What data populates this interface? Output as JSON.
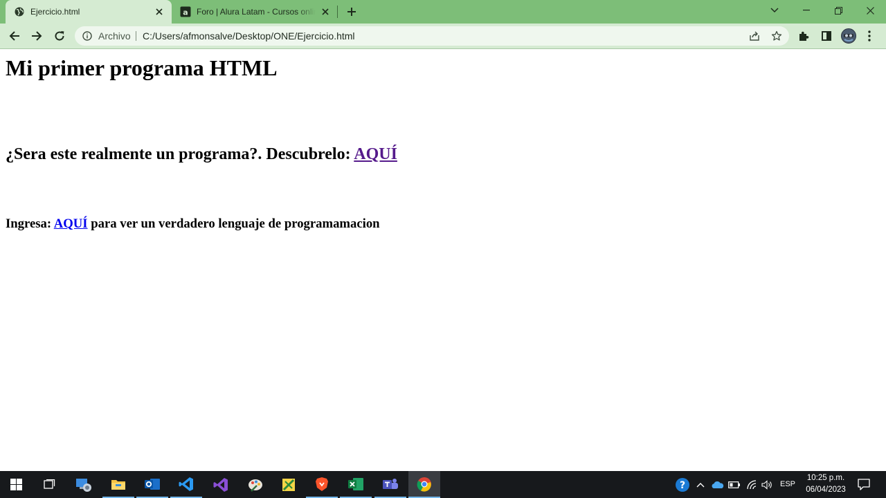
{
  "browser": {
    "tabs": [
      {
        "title": "Ejercicio.html",
        "active": true
      },
      {
        "title": "Foro | Alura Latam - Cursos online de tecnología",
        "active": false
      }
    ],
    "omnibox": {
      "chip_label": "Archivo",
      "url": "C:/Users/afmonsalve/Desktop/ONE/Ejercicio.html"
    },
    "colors": {
      "frame": "#7dbe78",
      "toolbar": "#d5ebd2"
    }
  },
  "page": {
    "heading": "Mi primer programa HTML",
    "question": {
      "text": "¿Sera este realmente un programa?. Descubrelo: ",
      "link": "AQUÍ"
    },
    "ingresa": {
      "prefix": "Ingresa: ",
      "link": "AQUÍ",
      "suffix": " para ver un verdadero lenguaje de programamacion"
    },
    "link_colors": {
      "visited": "#551a8b",
      "unvisited": "#0000ee"
    }
  },
  "taskbar": {
    "apps": [
      "start-icon",
      "task-view-icon",
      "remote-desktop-icon",
      "file-explorer-icon",
      "outlook-icon",
      "vscode-icon",
      "visual-studio-icon",
      "paint-app-icon",
      "sketch-app-icon",
      "brave-icon",
      "excel-icon",
      "teams-icon",
      "chrome-icon"
    ],
    "language": "ESP",
    "time": "10:25 p.m.",
    "date": "06/04/2023"
  }
}
